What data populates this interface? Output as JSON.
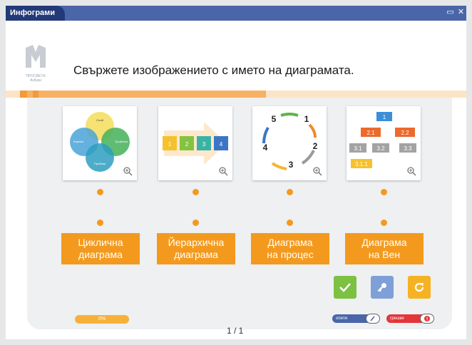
{
  "window": {
    "title": "Инфограми",
    "maximize_icon": "maximize-icon",
    "close_icon": "close-icon"
  },
  "logo": {
    "line1": "ПРОСВЕТА",
    "line2": "Азбуки"
  },
  "question": "Свържете изображението с името на диаграмата.",
  "cards": [
    {
      "icon": "venn-diagram-icon",
      "venn_labels": [
        "Слой",
        "Кореми",
        "Тромбоза",
        "Пробиви"
      ]
    },
    {
      "icon": "process-diagram-icon",
      "steps": [
        "1",
        "2",
        "3",
        "4"
      ]
    },
    {
      "icon": "cycle-diagram-icon",
      "numbers": [
        "5",
        "1",
        "2",
        "3",
        "4"
      ]
    },
    {
      "icon": "hierarchy-diagram-icon",
      "nodes": [
        "1",
        "2.1",
        "2.2",
        "3.1",
        "3.2",
        "3.3",
        "3.1.1"
      ]
    }
  ],
  "labels": [
    {
      "line1": "Циклична",
      "line2": "диаграма"
    },
    {
      "line1": "Йерархична",
      "line2": "диаграма"
    },
    {
      "line1": "Диаграма",
      "line2": "на процес"
    },
    {
      "line1": "Диаграма",
      "line2": "на Вен"
    }
  ],
  "buttons": {
    "check_icon": "check-icon",
    "key_icon": "key-icon",
    "reset_icon": "reset-icon"
  },
  "progress": {
    "label": "0%",
    "value": 0
  },
  "pager": "1 / 1",
  "toggles": {
    "attempts": "опити",
    "errors": "грешки"
  },
  "colors": {
    "accent": "#f39a1e",
    "titlebar": "#4a66a8",
    "check": "#7cc142",
    "key": "#7f9fd8",
    "reset": "#f5b323"
  }
}
